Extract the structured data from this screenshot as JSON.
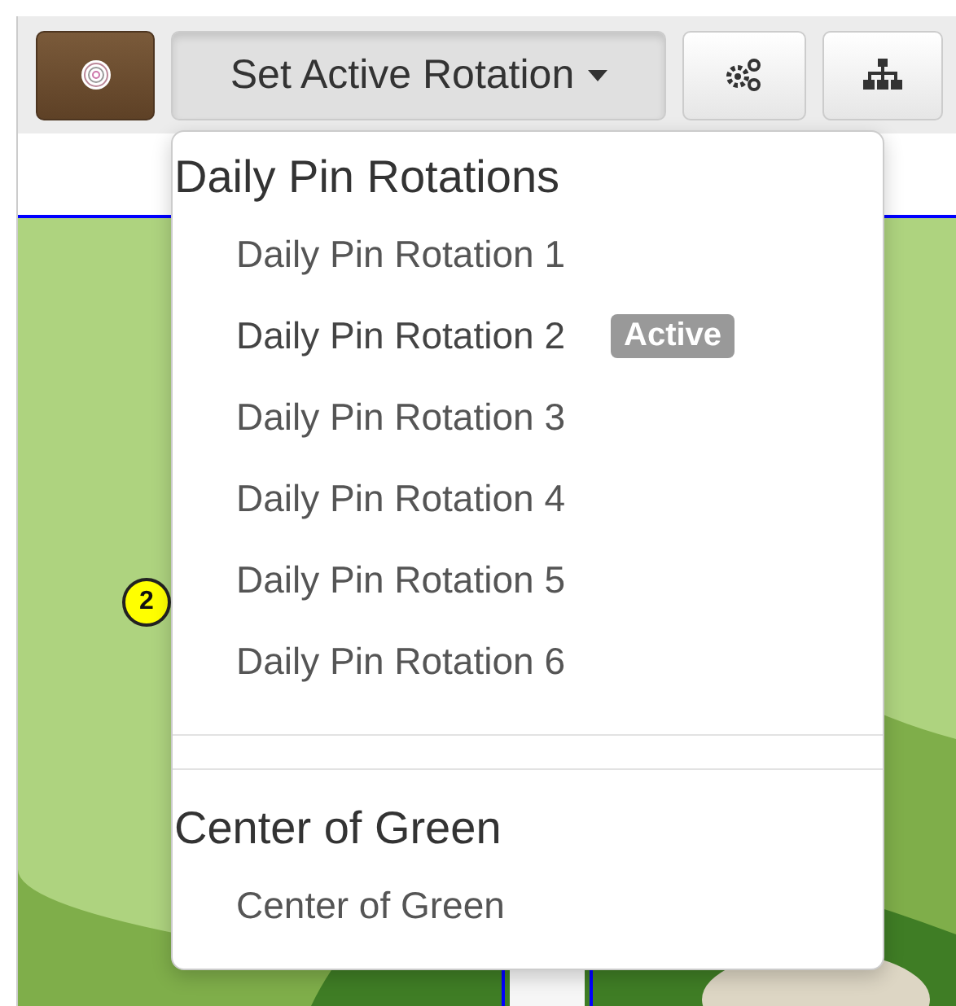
{
  "toolbar": {
    "rotation_button": {
      "label": "Set Active Rotation",
      "expanded": true
    }
  },
  "menu": {
    "active_badge": "Active",
    "groups": [
      {
        "header": "Daily Pin Rotations",
        "items": [
          {
            "label": "Daily Pin Rotation 1",
            "selected": false
          },
          {
            "label": "Daily Pin Rotation 2",
            "selected": true
          },
          {
            "label": "Daily Pin Rotation 3",
            "selected": false
          },
          {
            "label": "Daily Pin Rotation 4",
            "selected": false
          },
          {
            "label": "Daily Pin Rotation 5",
            "selected": false
          },
          {
            "label": "Daily Pin Rotation 6",
            "selected": false
          }
        ]
      },
      {
        "header": "Center of Green",
        "items": [
          {
            "label": "Center of Green",
            "selected": false
          }
        ]
      }
    ]
  },
  "map": {
    "pins": [
      {
        "label": "2"
      }
    ]
  }
}
